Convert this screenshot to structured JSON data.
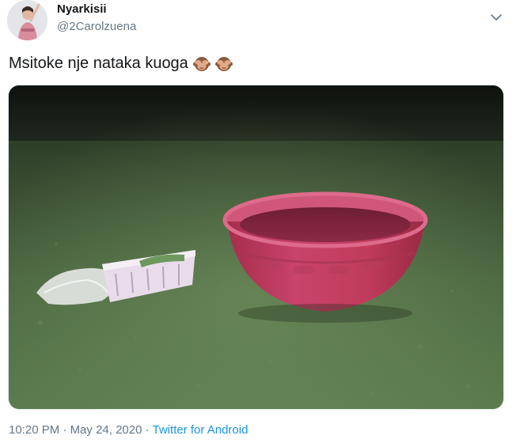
{
  "user": {
    "display_name": "Nyarkisii",
    "handle": "@2Carolzuena"
  },
  "tweet": {
    "text": "Msitoke nje nataka kuoga",
    "emojis": [
      "see-no-evil-monkey-icon",
      "see-no-evil-monkey-icon"
    ]
  },
  "meta": {
    "time": "10:20 PM",
    "separator_1": " · ",
    "date": "May 24, 2020",
    "separator_2": " · ",
    "source": "Twitter for Android"
  },
  "colors": {
    "text_primary": "#14171a",
    "text_secondary": "#657786",
    "link": "#1b95e0",
    "basin": "#c03c5c",
    "grass": "#3f5a36"
  }
}
